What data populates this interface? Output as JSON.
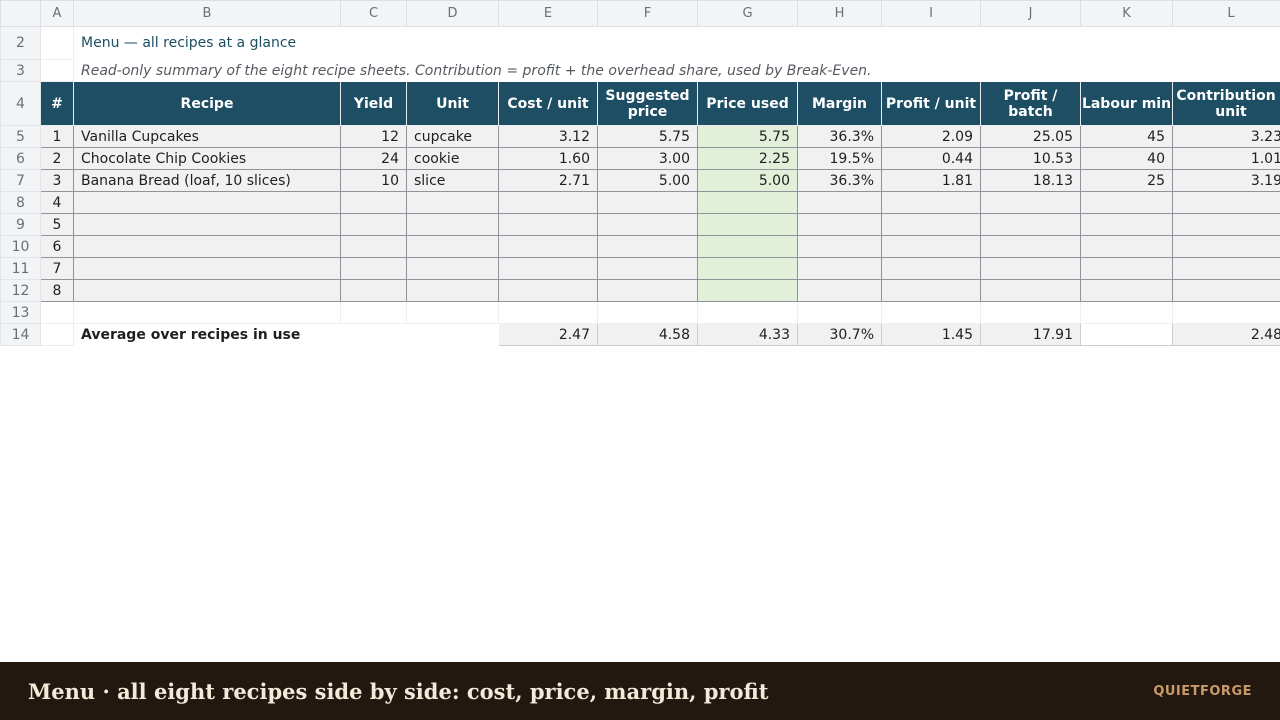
{
  "columns": [
    "A",
    "B",
    "C",
    "D",
    "E",
    "F",
    "G",
    "H",
    "I",
    "J",
    "K",
    "L"
  ],
  "row_numbers": [
    "2",
    "3",
    "4",
    "5",
    "6",
    "7",
    "8",
    "9",
    "10",
    "11",
    "12",
    "13",
    "14"
  ],
  "title": "Menu — all recipes at a glance",
  "subtitle": "Read-only summary of the eight recipe sheets. Contribution = profit + the overhead share, used by Break-Even.",
  "headers": [
    "#",
    "Recipe",
    "Yield",
    "Unit",
    "Cost / unit",
    "Suggested price",
    "Price used",
    "Margin",
    "Profit / unit",
    "Profit / batch",
    "Labour min",
    "Contribution / unit"
  ],
  "rows": [
    {
      "n": "1",
      "recipe": "Vanilla Cupcakes",
      "yield": "12",
      "unit": "cupcake",
      "cost": "3.12",
      "suggested": "5.75",
      "price": "5.75",
      "margin": "36.3%",
      "profit_unit": "2.09",
      "profit_batch": "25.05",
      "labour": "45",
      "contribution": "3.23"
    },
    {
      "n": "2",
      "recipe": "Chocolate Chip Cookies",
      "yield": "24",
      "unit": "cookie",
      "cost": "1.60",
      "suggested": "3.00",
      "price": "2.25",
      "margin": "19.5%",
      "profit_unit": "0.44",
      "profit_batch": "10.53",
      "labour": "40",
      "contribution": "1.01"
    },
    {
      "n": "3",
      "recipe": "Banana Bread (loaf, 10 slices)",
      "yield": "10",
      "unit": "slice",
      "cost": "2.71",
      "suggested": "5.00",
      "price": "5.00",
      "margin": "36.3%",
      "profit_unit": "1.81",
      "profit_batch": "18.13",
      "labour": "25",
      "contribution": "3.19"
    },
    {
      "n": "4"
    },
    {
      "n": "5"
    },
    {
      "n": "6"
    },
    {
      "n": "7"
    },
    {
      "n": "8"
    }
  ],
  "average": {
    "label": "Average over recipes in use",
    "cost": "2.47",
    "suggested": "4.58",
    "price": "4.33",
    "margin": "30.7%",
    "profit_unit": "1.45",
    "profit_batch": "17.91",
    "labour": "",
    "contribution": "2.48"
  },
  "footer": {
    "title": "Menu · all eight recipes side by side: cost, price, margin, profit",
    "brand": "QUIETFORGE"
  },
  "colors": {
    "header_bg": "#1d4e63",
    "price_used_bg": "#e2efd9",
    "footer_bg": "#22180f",
    "brand": "#c99a6a"
  }
}
